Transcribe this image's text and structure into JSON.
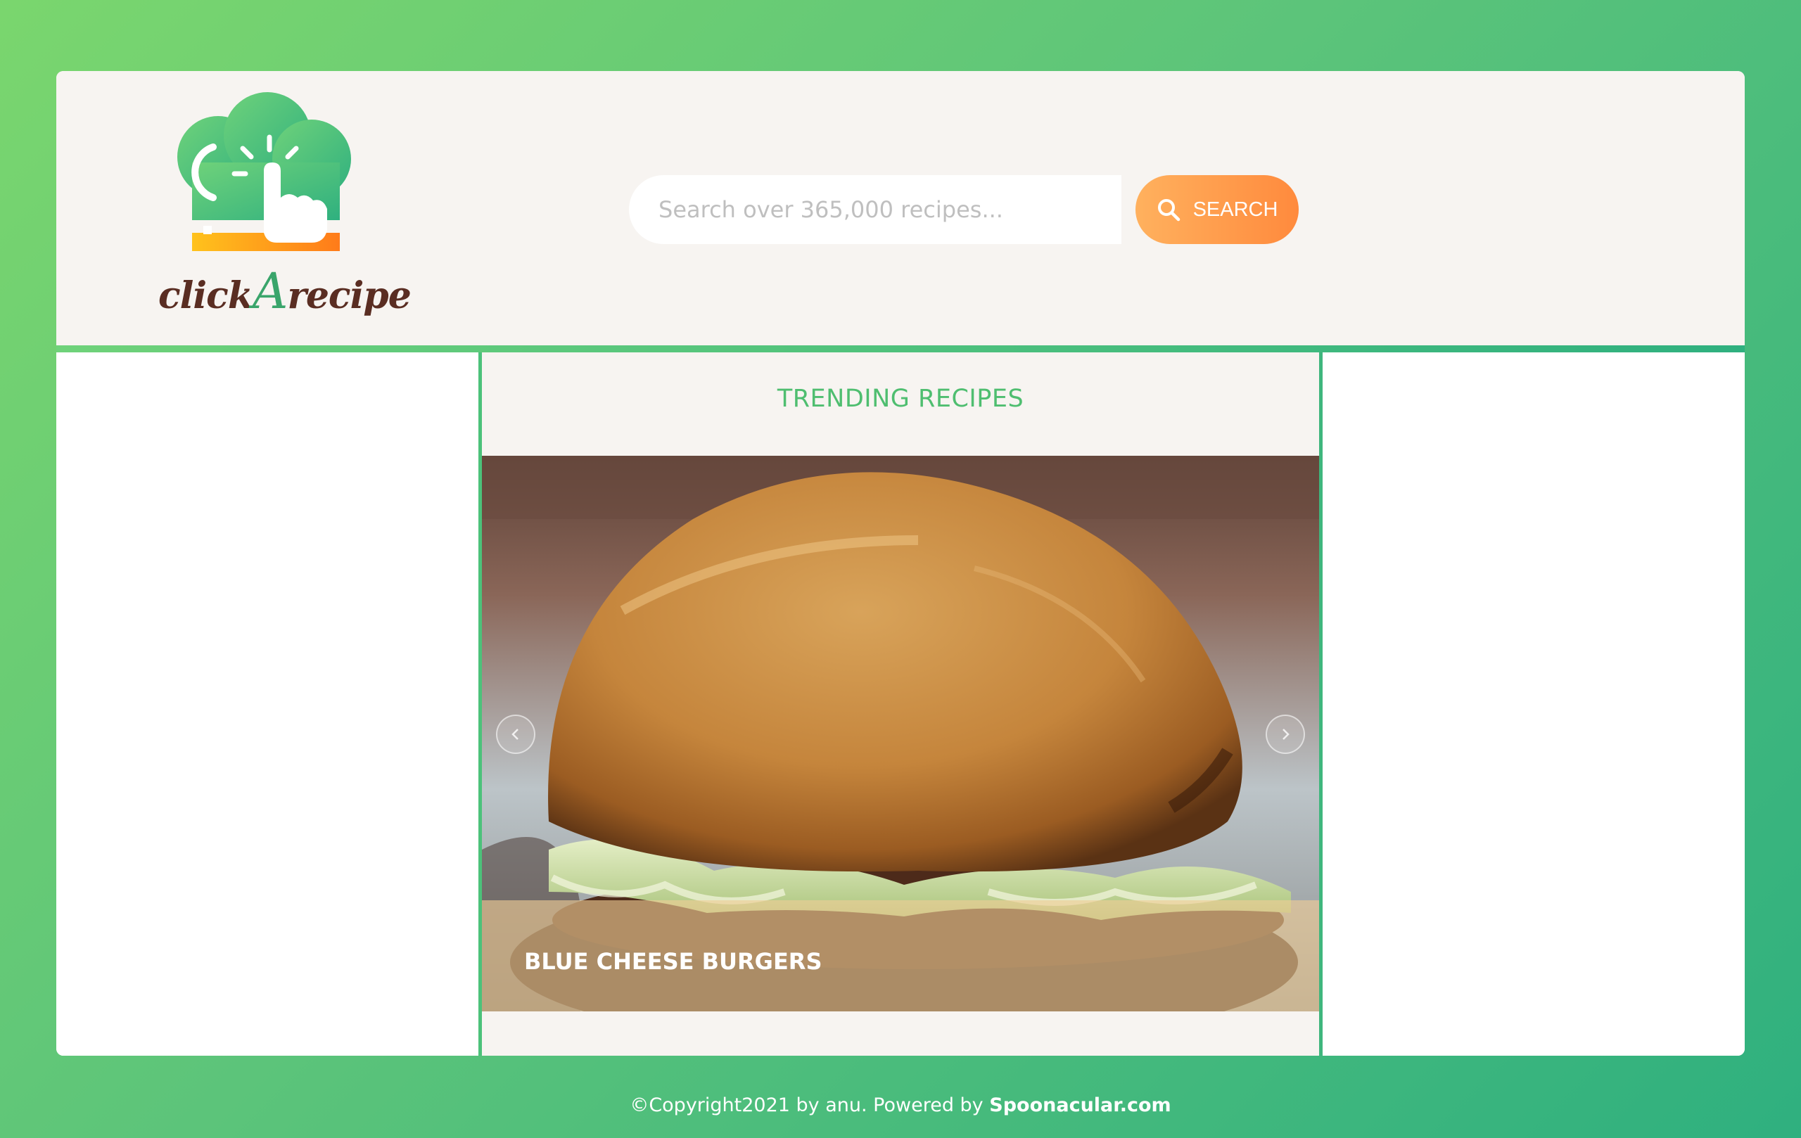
{
  "header": {
    "logo": {
      "text_prefix": "click",
      "text_letter": "A",
      "text_suffix": "recipe",
      "icon": "chef-hat-tap-icon"
    },
    "search": {
      "placeholder": "Search over 365,000 recipes...",
      "value": "",
      "button_label": "SEARCH",
      "button_icon": "search-icon"
    }
  },
  "trending": {
    "title": "TRENDING RECIPES",
    "current_slide": {
      "caption": "BLUE CHEESE BURGERS"
    },
    "prev_icon": "chevron-left-icon",
    "next_icon": "chevron-right-icon"
  },
  "footer": {
    "text": "©Copyright2021 by anu. Powered by ",
    "link_label": "Spoonacular.com"
  },
  "colors": {
    "accent_green": "#4fbe70",
    "search_orange": "#ff8a3d",
    "panel_bg": "#f7f4f1"
  }
}
